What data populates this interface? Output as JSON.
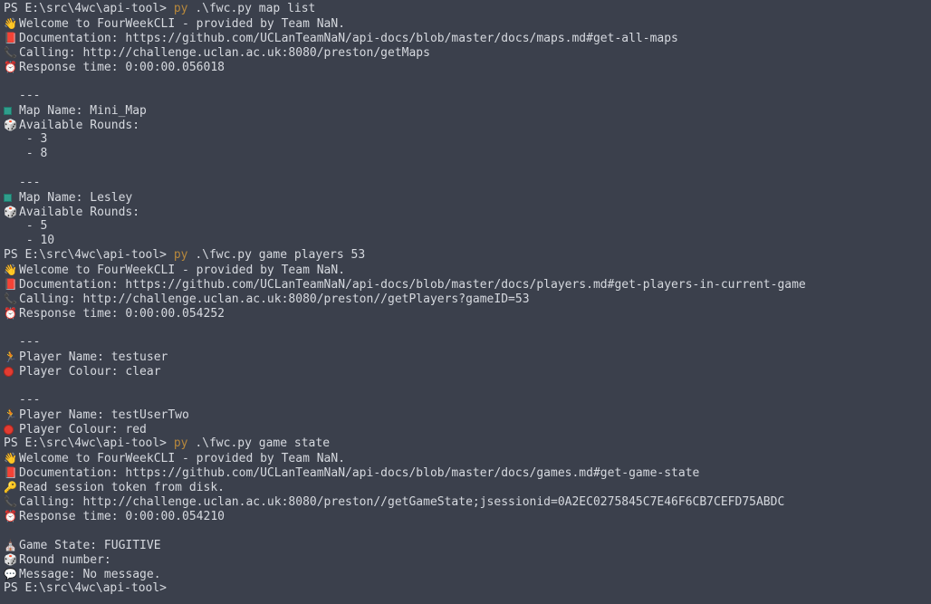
{
  "terminal": {
    "background_color": "#3b404c",
    "text_color": "#d6d9df",
    "accent_color": "#b7883c",
    "prompt": "PS E:\\src\\4wc\\api-tool>",
    "separator": "---"
  },
  "icons": {
    "wave": "waving-hand-icon",
    "book": "closed-book-icon",
    "phone": "telephone-receiver-icon",
    "clock": "alarm-clock-icon",
    "map": "map-icon",
    "die": "game-die-icon",
    "runner": "runner-icon",
    "key": "key-icon",
    "message": "speech-balloon-icon",
    "flag": "game-state-icon",
    "red_circle": "red-circle-icon"
  },
  "lines": [
    {
      "id": "l1",
      "icon": "none",
      "prompt": "PS E:\\src\\4wc\\api-tool>",
      "cmd_accent": "py",
      "cmd_rest": " .\\fwc.py map list"
    },
    {
      "id": "l2",
      "icon": "wave",
      "text": "Welcome to FourWeekCLI - provided by Team NaN."
    },
    {
      "id": "l3",
      "icon": "book",
      "text": "Documentation: https://github.com/UCLanTeamNaN/api-docs/blob/master/docs/maps.md#get-all-maps"
    },
    {
      "id": "l4",
      "icon": "phone",
      "text": "Calling: http://challenge.uclan.ac.uk:8080/preston/getMaps"
    },
    {
      "id": "l5",
      "icon": "clock",
      "text": "Response time: 0:00:00.056018"
    },
    {
      "id": "l6",
      "icon": "none",
      "text": ""
    },
    {
      "id": "l7",
      "icon": "none",
      "text": "---"
    },
    {
      "id": "l8",
      "icon": "map",
      "text": "Map Name: Mini_Map"
    },
    {
      "id": "l9",
      "icon": "die",
      "text": "Available Rounds:"
    },
    {
      "id": "l10",
      "icon": "none",
      "text": " - 3"
    },
    {
      "id": "l11",
      "icon": "none",
      "text": " - 8"
    },
    {
      "id": "l12",
      "icon": "none",
      "text": ""
    },
    {
      "id": "l13",
      "icon": "none",
      "text": "---"
    },
    {
      "id": "l14",
      "icon": "map",
      "text": "Map Name: Lesley"
    },
    {
      "id": "l15",
      "icon": "die",
      "text": "Available Rounds:"
    },
    {
      "id": "l16",
      "icon": "none",
      "text": " - 5"
    },
    {
      "id": "l17",
      "icon": "none",
      "text": " - 10"
    },
    {
      "id": "l18",
      "icon": "none",
      "prompt": "PS E:\\src\\4wc\\api-tool>",
      "cmd_accent": "py",
      "cmd_rest": " .\\fwc.py game players 53"
    },
    {
      "id": "l19",
      "icon": "wave",
      "text": "Welcome to FourWeekCLI - provided by Team NaN."
    },
    {
      "id": "l20",
      "icon": "book",
      "text": "Documentation: https://github.com/UCLanTeamNaN/api-docs/blob/master/docs/players.md#get-players-in-current-game"
    },
    {
      "id": "l21",
      "icon": "phone",
      "text": "Calling: http://challenge.uclan.ac.uk:8080/preston//getPlayers?gameID=53"
    },
    {
      "id": "l22",
      "icon": "clock",
      "text": "Response time: 0:00:00.054252"
    },
    {
      "id": "l23",
      "icon": "none",
      "text": ""
    },
    {
      "id": "l24",
      "icon": "none",
      "text": "---"
    },
    {
      "id": "l25",
      "icon": "runner",
      "text": "Player Name: testuser"
    },
    {
      "id": "l26",
      "icon": "red_circle",
      "text": "Player Colour: clear"
    },
    {
      "id": "l27",
      "icon": "none",
      "text": ""
    },
    {
      "id": "l28",
      "icon": "none",
      "text": "---"
    },
    {
      "id": "l29",
      "icon": "runner",
      "text": "Player Name: testUserTwo"
    },
    {
      "id": "l30",
      "icon": "red_circle",
      "text": "Player Colour: red"
    },
    {
      "id": "l31",
      "icon": "none",
      "prompt": "PS E:\\src\\4wc\\api-tool>",
      "cmd_accent": "py",
      "cmd_rest": " .\\fwc.py game state"
    },
    {
      "id": "l32",
      "icon": "wave",
      "text": "Welcome to FourWeekCLI - provided by Team NaN."
    },
    {
      "id": "l33",
      "icon": "book",
      "text": "Documentation: https://github.com/UCLanTeamNaN/api-docs/blob/master/docs/games.md#get-game-state"
    },
    {
      "id": "l34",
      "icon": "key",
      "text": "Read session token from disk."
    },
    {
      "id": "l35",
      "icon": "phone",
      "text": "Calling: http://challenge.uclan.ac.uk:8080/preston//getGameState;jsessionid=0A2EC0275845C7E46F6CB7CEFD75ABDC"
    },
    {
      "id": "l36",
      "icon": "clock",
      "text": "Response time: 0:00:00.054210"
    },
    {
      "id": "l37",
      "icon": "none",
      "text": ""
    },
    {
      "id": "l38",
      "icon": "flag",
      "text": "Game State: FUGITIVE"
    },
    {
      "id": "l39",
      "icon": "die",
      "text": "Round number:"
    },
    {
      "id": "l40",
      "icon": "message",
      "text": "Message: No message."
    },
    {
      "id": "l41",
      "icon": "none",
      "prompt": "PS E:\\src\\4wc\\api-tool>",
      "cmd_accent": "",
      "cmd_rest": ""
    }
  ]
}
